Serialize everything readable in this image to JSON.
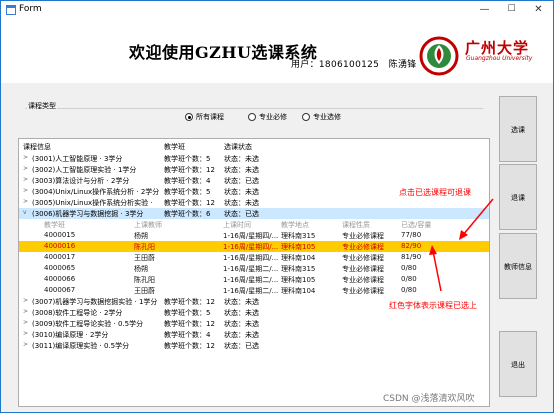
{
  "window": {
    "title": "Form",
    "min": "—",
    "max": "☐",
    "close": "✕"
  },
  "header": {
    "welcome": "欢迎使用GZHU选课系统",
    "user_label": "用户：",
    "user_id": "1806100125",
    "user_name": "陈湧锋",
    "logo_text": "广州大学",
    "logo_sub": "Guangzhou University",
    "logo_color": "#c00000"
  },
  "filter": {
    "group_label": "课程类型",
    "options": [
      {
        "label": "所有课程",
        "checked": true
      },
      {
        "label": "专业必修",
        "checked": false
      },
      {
        "label": "专业选修",
        "checked": false
      }
    ]
  },
  "tree": {
    "headers": [
      "课程信息",
      "教学班",
      "选课状态"
    ],
    "courses": [
      {
        "info": "(3001)人工智能原理 · 3学分",
        "cls": "教学班个数：5",
        "status": "状态：未选"
      },
      {
        "info": "(3002)人工智能原理实验 · 1学分",
        "cls": "教学班个数：12",
        "status": "状态：未选"
      },
      {
        "info": "(3003)算法设计与分析 · 2学分",
        "cls": "教学班个数：4",
        "status": "状态：已选"
      },
      {
        "info": "(3004)Unix/Linux操作系统分析 · 2学分",
        "cls": "教学班个数：5",
        "status": "状态：未选"
      },
      {
        "info": "(3005)Unix/Linux操作系统分析实验 ·",
        "cls": "教学班个数：12",
        "status": "状态：未选"
      },
      {
        "info": "(3006)机器学习与数据挖掘 · 3学分",
        "cls": "教学班个数：6",
        "status": "状态：已选"
      }
    ],
    "sub_headers": [
      "教学班",
      "上课教师",
      "上课时间",
      "教学地点",
      "课程性质",
      "已选/容量"
    ],
    "sections": [
      {
        "id": "4000015",
        "teacher": "杨朔",
        "time": "1-16周/星期四/...",
        "place": "理科南315",
        "type": "专业必修课程",
        "count": "77/80"
      },
      {
        "id": "4000016",
        "teacher": "陈孔阳",
        "time": "1-16周/星期四/...",
        "place": "理科南105",
        "type": "专业必修课程",
        "count": "82/90"
      },
      {
        "id": "4000017",
        "teacher": "王田蔚",
        "time": "1-16周/星期四/...",
        "place": "理科南104",
        "type": "专业必修课程",
        "count": "81/90"
      },
      {
        "id": "4000065",
        "teacher": "杨朔",
        "time": "1-16周/星期二/...",
        "place": "理科南315",
        "type": "专业必修课程",
        "count": "0/80"
      },
      {
        "id": "4000066",
        "teacher": "陈孔阳",
        "time": "1-16周/星期二/...",
        "place": "理科南105",
        "type": "专业必修课程",
        "count": "0/80"
      },
      {
        "id": "4000067",
        "teacher": "王田蔚",
        "time": "1-16周/星期二/...",
        "place": "理科南104",
        "type": "专业必修课程",
        "count": "0/80"
      }
    ],
    "courses2": [
      {
        "info": "(3007)机器学习与数据挖掘实验 · 1学分",
        "cls": "教学班个数：12",
        "status": "状态：未选"
      },
      {
        "info": "(3008)软件工程导论 · 2学分",
        "cls": "教学班个数：5",
        "status": "状态：未选"
      },
      {
        "info": "(3009)软件工程导论实验 · 0.5学分",
        "cls": "教学班个数：12",
        "status": "状态：未选"
      },
      {
        "info": "(3010)编译原理 · 2学分",
        "cls": "教学班个数：4",
        "status": "状态：未选"
      },
      {
        "info": "(3011)编译原理实验 · 0.5学分",
        "cls": "教学班个数：12",
        "status": "状态：已选"
      }
    ]
  },
  "buttons": {
    "select": "选课",
    "drop": "退课",
    "info": "教师信息",
    "exit": "退出"
  },
  "notes": {
    "drop_hint": "点击已选课程可退课",
    "red_hint": "红色字体表示课程已选上",
    "color": "#ff0000"
  },
  "watermark": "CSDN @浅落清欢风吹"
}
